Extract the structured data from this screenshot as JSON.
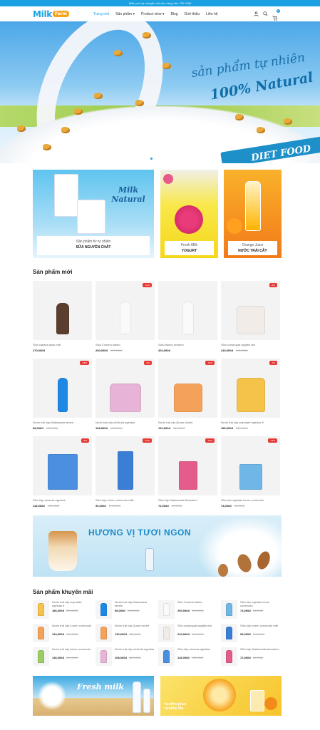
{
  "topbar": {
    "text": "Miễn phí vận chuyển với đơn hàng trên 750.000đ"
  },
  "logo": {
    "part1": "Milk",
    "part2": "Farm"
  },
  "nav": [
    {
      "label": "Trang chủ"
    },
    {
      "label": "Sản phẩm ▾"
    },
    {
      "label": "Product view ▾"
    },
    {
      "label": "Blog"
    },
    {
      "label": "Giới thiệu"
    },
    {
      "label": "Liên hệ"
    }
  ],
  "cart": {
    "count": "0"
  },
  "hero": {
    "line1": "sản phẩm tự nhiên",
    "line2": "100% Natural",
    "line3": "DIET FOOD"
  },
  "banners": [
    {
      "subtitle": "Sản phẩm từ tự nhiên",
      "title": "SỮA NGUYÊN CHẤT",
      "logo_text": "Milk Natural"
    },
    {
      "subtitle": "Fresh Milk",
      "title": "YOGURT"
    },
    {
      "subtitle": "Orange Juice",
      "title": "NƯỚC TRÁI CÂY"
    }
  ],
  "new_products": {
    "title": "Sản phẩm mới",
    "items": [
      {
        "name": "Sữa cabana dysk milk",
        "price": "270,000đ",
        "old": "",
        "badge": ""
      },
      {
        "name": "Sữa Comma habito",
        "price": "290,000đ",
        "old": "310,000đ",
        "badge": "-10%"
      },
      {
        "name": "Sữa blanca zenkem",
        "price": "320,000đ",
        "old": "",
        "badge": ""
      },
      {
        "name": "Sữa consequat sagittis rich",
        "price": "240,000đ",
        "old": "260,000đ",
        "badge": "-8%"
      },
      {
        "name": "Nước trái cây Malesuada fames",
        "price": "98,000đ",
        "old": "120,000đ",
        "badge": "-18%"
      },
      {
        "name": "Nước trái cây vehicula egestas",
        "price": "168,000đ",
        "old": "180,000đ",
        "badge": "-6%"
      },
      {
        "name": "Nước trái cây Quam viridet",
        "price": "132,000đ",
        "old": "150,000đ",
        "badge": "-12%"
      },
      {
        "name": "Nước trái cây vulputate egestas ti",
        "price": "186,000đ",
        "old": "200,000đ",
        "badge": "-7%"
      },
      {
        "name": "Sữa hộp aruscas egestas",
        "price": "118,000đ",
        "old": "130,000đ",
        "badge": "-9%"
      },
      {
        "name": "Sữa hộp lorem commodo milk",
        "price": "99,000đ",
        "old": "110,000đ",
        "badge": "-10%"
      },
      {
        "name": "Sữa hộp Malesuada bibendum",
        "price": "72,000đ",
        "old": "80,000đ",
        "badge": "-10%"
      },
      {
        "name": "Sữa hộc egestas lorem commodo",
        "price": "74,000đ",
        "old": "84,000đ",
        "badge": "-12%"
      }
    ]
  },
  "mid_banner": {
    "text": "HƯƠNG VỊ TƯƠI NGON"
  },
  "promo_products": {
    "title": "Sản phẩm khuyến mãi",
    "items": [
      {
        "name": "Nước trái cây vulputate egestas ti",
        "price": "186,000đ",
        "old": "200,000đ"
      },
      {
        "name": "Nước trái cây Malesuada fames",
        "price": "98,000đ",
        "old": "120,000đ"
      },
      {
        "name": "Sữa Comma habito",
        "price": "290,000đ",
        "old": "310,000đ"
      },
      {
        "name": "Sữa hộc egestas lorem commodo",
        "price": "74,000đ",
        "old": "84,000đ"
      },
      {
        "name": "Nước trái cây Lorem commodo",
        "price": "144,000đ",
        "old": "160,000đ"
      },
      {
        "name": "Nước trái cây Quam viridet",
        "price": "132,000đ",
        "old": "150,000đ"
      },
      {
        "name": "Sữa consequat sagittis rich",
        "price": "240,000đ",
        "old": "260,000đ"
      },
      {
        "name": "Sữa hộp lorem commodo milk",
        "price": "99,000đ",
        "old": "110,000đ"
      },
      {
        "name": "Nước trái cây lorem commodo",
        "price": "146,000đ",
        "old": "160,000đ"
      },
      {
        "name": "Nước trái cây vehicula egestas",
        "price": "168,000đ",
        "old": "180,000đ"
      },
      {
        "name": "Sữa hộp aruscas egestas",
        "price": "118,000đ",
        "old": "130,000đ"
      },
      {
        "name": "Sữa hộp Malesuada bibendum",
        "price": "72,000đ",
        "old": "80,000đ"
      }
    ]
  },
  "bottom_banners": [
    {
      "text": "Fresh milk"
    },
    {
      "text": "healthy juice. healthy life."
    }
  ],
  "colors": {
    "accent": "#1ba1e2",
    "brand_orange": "#f7a21b",
    "sale": "#e53935"
  }
}
